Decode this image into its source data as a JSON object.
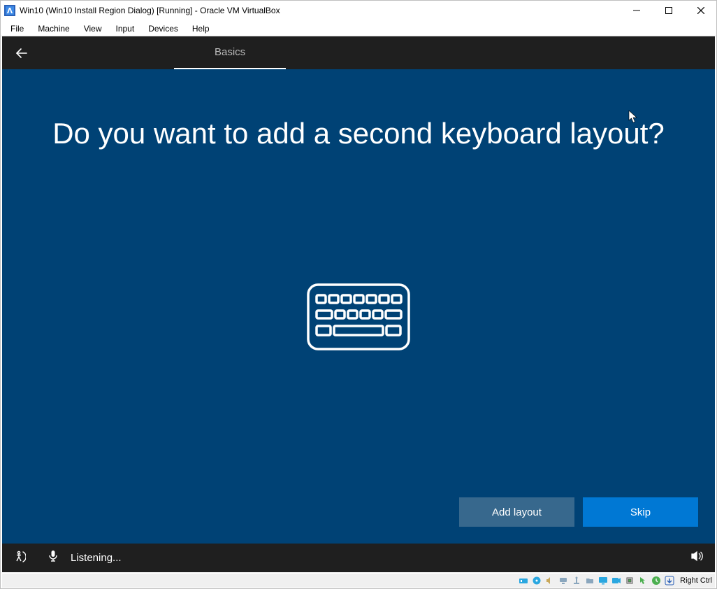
{
  "window": {
    "title": "Win10 (Win10 Install Region Dialog) [Running] - Oracle VM VirtualBox"
  },
  "menu": {
    "file": "File",
    "machine": "Machine",
    "view": "View",
    "input": "Input",
    "devices": "Devices",
    "help": "Help"
  },
  "oobe": {
    "tab": "Basics",
    "heading": "Do you want to add a second keyboard layout?",
    "add_label": "Add layout",
    "skip_label": "Skip",
    "listening": "Listening..."
  },
  "vbox_status": {
    "hostkey": "Right Ctrl"
  }
}
